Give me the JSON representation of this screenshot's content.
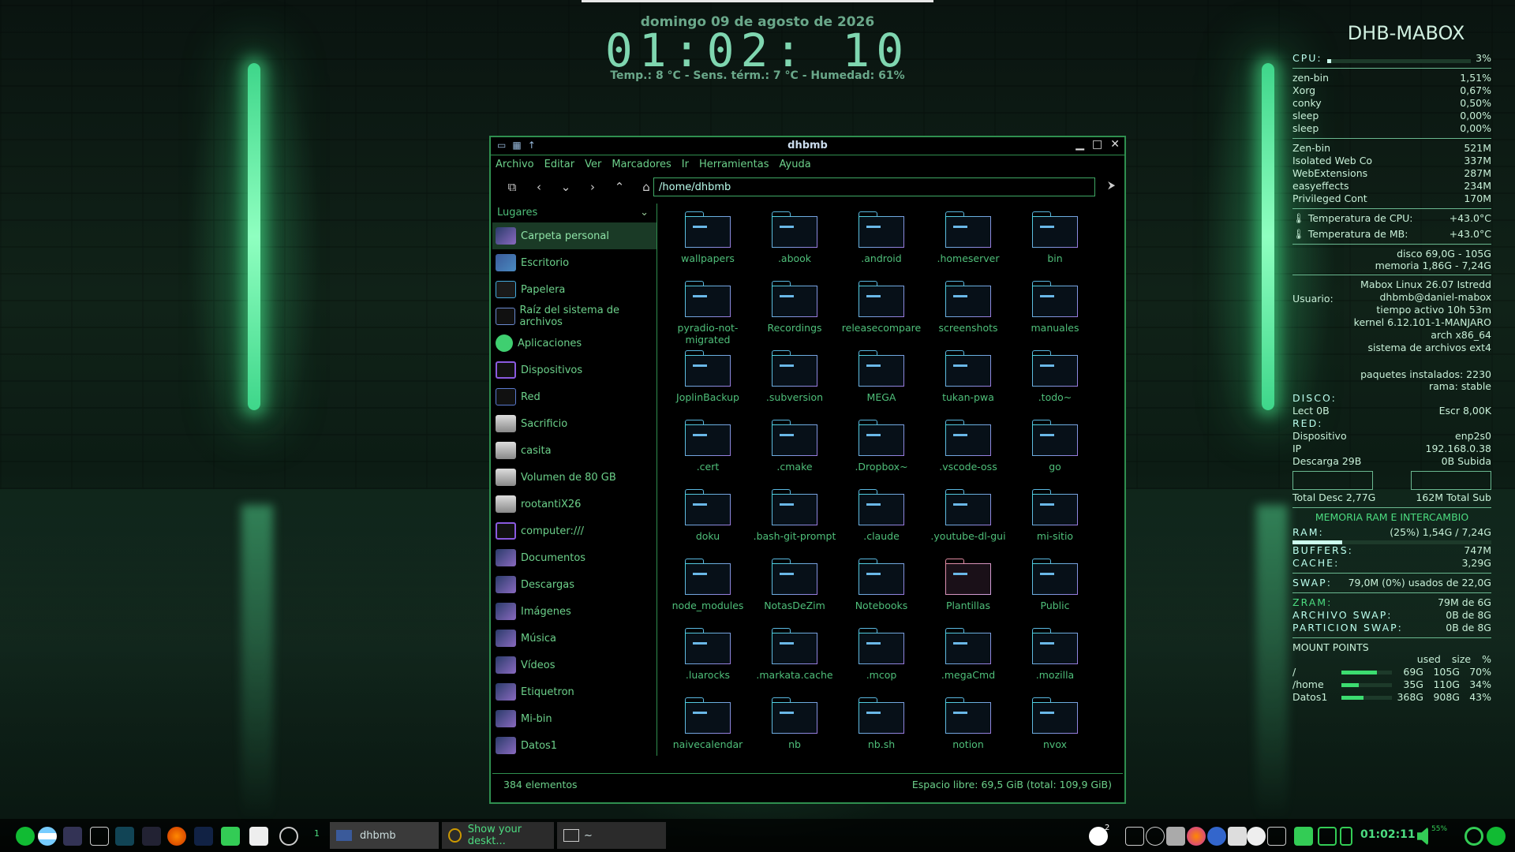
{
  "clock": {
    "date": "domingo 09 de agosto de 2026",
    "time": "01:02: 10",
    "weather": "Temp.: 8 °C  - Sens. térm.: 7 °C - Humedad: 61%"
  },
  "file_manager": {
    "title": "dhbmb",
    "menu": [
      "Archivo",
      "Editar",
      "Ver",
      "Marcadores",
      "Ir",
      "Herramientas",
      "Ayuda"
    ],
    "path": "/home/dhbmb",
    "places_header": "Lugares",
    "places": [
      {
        "label": "Carpeta personal",
        "icon": "home-folder-icon"
      },
      {
        "label": "Escritorio",
        "icon": "desktop-icon"
      },
      {
        "label": "Papelera",
        "icon": "trash-icon"
      },
      {
        "label": "Raíz del sistema de archivos",
        "icon": "root-fs-icon"
      },
      {
        "label": "Aplicaciones",
        "icon": "applications-icon"
      },
      {
        "label": "Dispositivos",
        "icon": "monitor-icon"
      },
      {
        "label": "Red",
        "icon": "network-icon"
      },
      {
        "label": "Sacrificio",
        "icon": "disk-icon"
      },
      {
        "label": "casita",
        "icon": "disk-icon"
      },
      {
        "label": "Volumen de 80 GB",
        "icon": "disk-icon"
      },
      {
        "label": "rootantiX26",
        "icon": "disk-icon"
      },
      {
        "label": "computer:///",
        "icon": "monitor-icon"
      },
      {
        "label": "Documentos",
        "icon": "folder-icon"
      },
      {
        "label": "Descargas",
        "icon": "folder-icon"
      },
      {
        "label": "Imágenes",
        "icon": "folder-icon"
      },
      {
        "label": "Música",
        "icon": "folder-icon"
      },
      {
        "label": "Vídeos",
        "icon": "folder-icon"
      },
      {
        "label": "Etiquetron",
        "icon": "folder-icon"
      },
      {
        "label": "Mi-bin",
        "icon": "folder-icon"
      },
      {
        "label": "Datos1",
        "icon": "folder-icon"
      }
    ],
    "folders": [
      "wallpapers",
      ".abook",
      ".android",
      ".homeserver",
      "bin",
      "pyradio-not-migrated",
      "Recordings",
      "releasecompare",
      "screenshots",
      "manuales",
      "JoplinBackup",
      ".subversion",
      "MEGA",
      "tukan-pwa",
      ".todo~",
      ".cert",
      ".cmake",
      ".Dropbox~",
      ".vscode-oss",
      "go",
      "doku",
      ".bash-git-prompt",
      ".claude",
      ".youtube-dl-gui",
      "mi-sitio",
      "node_modules",
      "NotasDeZim",
      "Notebooks",
      "Plantillas",
      "Public",
      ".luarocks",
      ".markata.cache",
      ".mcop",
      ".megaCmd",
      ".mozilla",
      "naivecalendar",
      "nb",
      "nb.sh",
      "notion",
      "nvox"
    ],
    "status_count": "384 elementos",
    "status_space": "Espacio libre: 69,5 GiB (total: 109,9 GiB)"
  },
  "conky": {
    "host": "DHB-MABOX",
    "cpu_label": "CPU:",
    "cpu_value": "3%",
    "cpu_level": 0.03,
    "procs_cpu": [
      [
        "zen-bin",
        "1,51%"
      ],
      [
        "Xorg",
        "0,67%"
      ],
      [
        "conky",
        "0,50%"
      ],
      [
        "sleep",
        "0,00%"
      ],
      [
        "sleep",
        "0,00%"
      ]
    ],
    "procs_mem": [
      [
        "Zen-bin",
        "521M"
      ],
      [
        "Isolated Web Co",
        "337M"
      ],
      [
        "WebExtensions",
        "287M"
      ],
      [
        "easyeffects",
        "234M"
      ],
      [
        "Privileged Cont",
        "170M"
      ]
    ],
    "temp_cpu_label": "Temperatura de  CPU:",
    "temp_cpu": "+43.0°C",
    "temp_mb_label": "Temperatura de  MB:",
    "temp_mb": "+43.0°C",
    "disk_line": "disco 69,0G - 105G",
    "mem_line": "memoria 1,86G - 7,24G",
    "user_label": "Usuario:",
    "sys_info": [
      "Mabox Linux 26.07 Istredd",
      "dhbmb@daniel-mabox",
      "tiempo activo 10h 53m",
      "kernel 6.12.101-1-MANJARO",
      "arch x86_64",
      "sistema de archivos ext4"
    ],
    "packages": "paquetes instalados: 2230",
    "branch": "rama: stable",
    "disk_header": "DISCO:",
    "disk_read": "Lect 0B",
    "disk_write": "Escr 8,00K",
    "net_header": "RED:",
    "net_device_label": "Dispositivo",
    "net_device": "enp2s0",
    "ip_label": "IP",
    "ip": "192.168.0.38",
    "down": "Descarga 29B",
    "up": "0B Subida",
    "total_down": "Total Desc 2,77G",
    "total_up": "162M Total Sub",
    "ram_header": "MEMORIA RAM E INTERCAMBIO",
    "ram_label": "RAM:",
    "ram_value": "(25%) 1,54G / 7,24G",
    "ram_level": 0.25,
    "buffers_label": "BUFFERS:",
    "buffers": "747M",
    "cache_label": "CACHE:",
    "cache": "3,29G",
    "swap_label": "SWAP:",
    "swap": "79,0M (0%) usados de 22,0G",
    "zram_label": "ZRAM:",
    "zram": "79M de 6G",
    "swapfile_label": "ARCHIVO SWAP:",
    "swapfile": "0B de 8G",
    "swappart_label": "PARTICION SWAP:",
    "swappart": "0B de 8G",
    "mount_header": "MOUNT POINTS",
    "mount_cols": [
      "used",
      "size",
      "%"
    ],
    "mounts": [
      {
        "name": "/",
        "used": "69G",
        "size": "105G",
        "pct": "70%",
        "level": 0.7
      },
      {
        "name": "/home",
        "used": "35G",
        "size": "110G",
        "pct": "34%",
        "level": 0.34
      },
      {
        "name": "Datos1",
        "used": "368G",
        "size": "908G",
        "pct": "43%",
        "level": 0.43
      }
    ]
  },
  "taskbar": {
    "workspace": "1",
    "tasks": [
      "dhbmb",
      "Show your deskt...",
      "~"
    ],
    "notif_count": "2",
    "volume": "55%",
    "time": "01:02:11"
  }
}
